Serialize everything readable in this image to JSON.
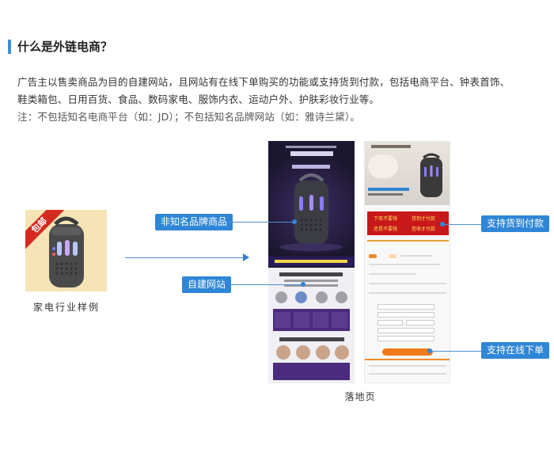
{
  "heading": "什么是外链电商？",
  "paragraph_line1": "广告主以售卖商品为目的自建网站，且网站有在线下单购买的功能或支持货到付款，包括电商平台、钟表首饰、",
  "paragraph_line2": "鞋类箱包、日用百货、食品、数码家电、服饰内衣、运动户外、护肤彩妆行业等。",
  "note": "注：不包括知名电商平台（如：JD）；不包括知名品牌网站（如：雅诗兰黛）。",
  "sample": {
    "ribbon": "包邮",
    "caption": "家电行业样例"
  },
  "tags": {
    "non_famous_brand": "非知名品牌商品",
    "self_built_site": "自建网站",
    "cod_support": "支持货到付款",
    "online_order": "支持在线下单"
  },
  "landing_caption": "落地页",
  "colors": {
    "accent_blue": "#2f86d6",
    "ribbon_red": "#d52a1f",
    "heading_bar": "#3d8fd4"
  }
}
